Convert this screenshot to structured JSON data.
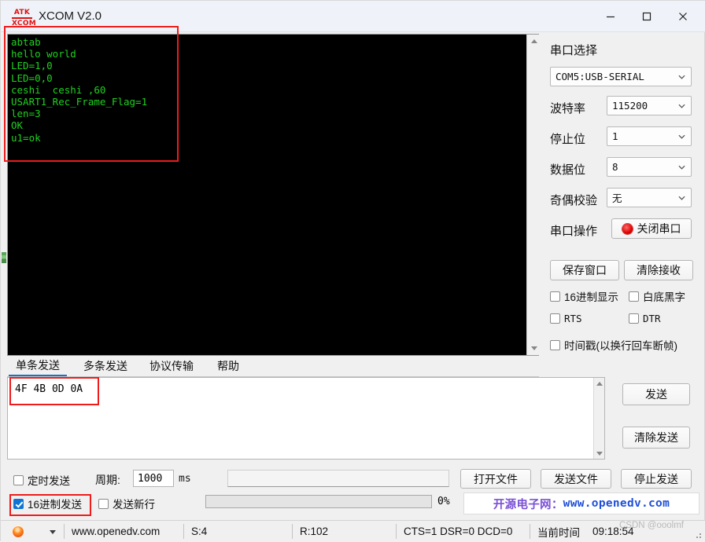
{
  "window": {
    "title": "XCOM V2.0",
    "logo_line1": "ATK",
    "logo_line2": "XCOM",
    "minimize": "minimize",
    "maximize": "maximize",
    "close": "close"
  },
  "receive": {
    "text": "abtab\nhello world\nLED=1,0\nLED=0,0\nceshi  ceshi ,60\nUSART1_Rec_Frame_Flag=1\nlen=3\nOK\nu1=ok",
    "text_color": "#20d020",
    "background": "#000000",
    "highlight_color": "#ee1c1c"
  },
  "tabs": [
    {
      "label": "单条发送",
      "active": true
    },
    {
      "label": "多条发送",
      "active": false
    },
    {
      "label": "协议传输",
      "active": false
    },
    {
      "label": "帮助",
      "active": false
    }
  ],
  "send": {
    "value": "4F 4B 0D 0A",
    "send_button": "发送",
    "clear_send_button": "清除发送"
  },
  "sidebar": {
    "port_select_label": "串口选择",
    "port_value": "COM5:USB-SERIAL",
    "baud_label": "波特率",
    "baud_value": "115200",
    "stopbits_label": "停止位",
    "stopbits_value": "1",
    "databits_label": "数据位",
    "databits_value": "8",
    "parity_label": "奇偶校验",
    "parity_value": "无",
    "serial_op_label": "串口操作",
    "serial_op_button": "关闭串口",
    "save_window_button": "保存窗口",
    "clear_recv_button": "清除接收",
    "checkboxes": [
      {
        "label": "16进制显示",
        "checked": false
      },
      {
        "label": "白底黑字",
        "checked": false
      },
      {
        "label": "RTS",
        "checked": false
      },
      {
        "label": "DTR",
        "checked": false
      },
      {
        "label": "时间戳(以换行回车断帧)",
        "checked": false
      }
    ]
  },
  "bottom": {
    "timed_send_label": "定时发送",
    "timed_send_checked": false,
    "period_label": "周期:",
    "period_value": "1000",
    "period_unit": "ms",
    "file_path_value": "",
    "hex_send_label": "16进制发送",
    "hex_send_checked": true,
    "newline_send_label": "发送新行",
    "newline_send_checked": false,
    "progress_percent": "0%",
    "open_file_button": "打开文件",
    "send_file_button": "发送文件",
    "stop_send_button": "停止发送",
    "watermark_cn": "开源电子网：",
    "watermark_en": "www.openedv.com"
  },
  "statusbar": {
    "site": "www.openedv.com",
    "sent": "S:4",
    "received": "R:102",
    "signals": "CTS=1 DSR=0 DCD=0",
    "time_label": "当前时间",
    "time_value": "09:18:54",
    "watermark": "CSDN @ooolmf"
  }
}
